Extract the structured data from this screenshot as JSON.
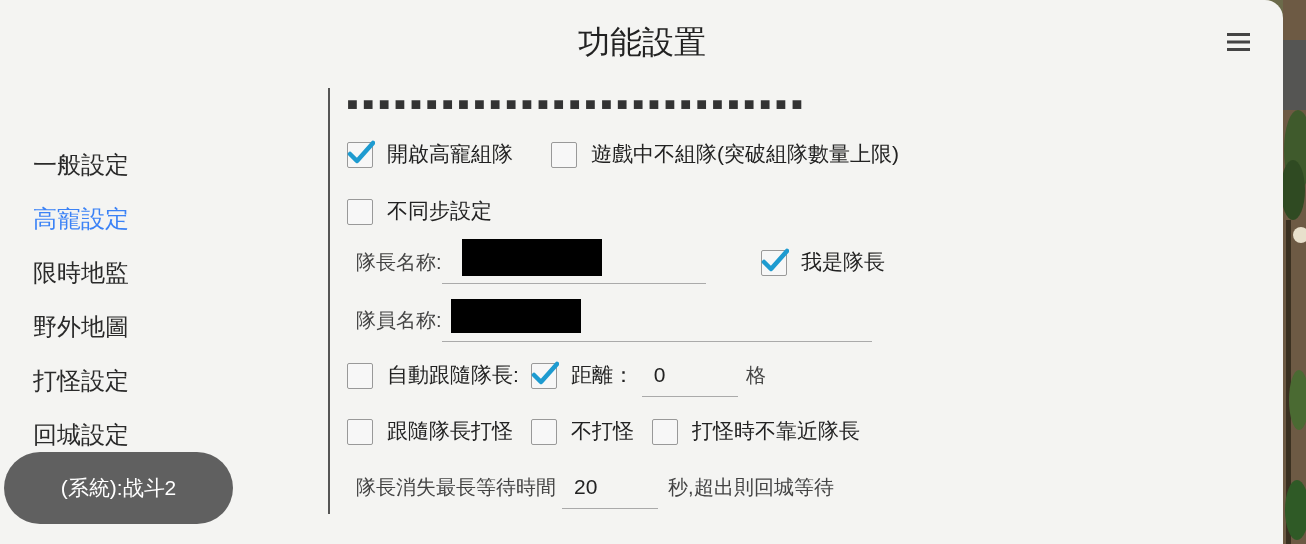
{
  "title": "功能設置",
  "sidebar": {
    "items": [
      {
        "label": "一般設定",
        "selected": false
      },
      {
        "label": "高寵設定",
        "selected": true
      },
      {
        "label": "限時地監",
        "selected": false
      },
      {
        "label": "野外地圖",
        "selected": false
      },
      {
        "label": "打怪設定",
        "selected": false
      },
      {
        "label": "回城設定",
        "selected": false
      }
    ]
  },
  "toast": "(系統):战斗2",
  "header_marks": "■■■■■■■■■■■■■■■■■■■■■■■■■■■■■",
  "rows": [
    [
      {
        "kind": "checkbox",
        "label": "開啟高寵組隊",
        "checked": true
      },
      {
        "kind": "checkbox",
        "label": "遊戲中不組隊(突破組隊數量上限)",
        "checked": false
      }
    ],
    [
      {
        "kind": "checkbox",
        "label": "不同步設定",
        "checked": false
      }
    ],
    [
      {
        "kind": "label",
        "text": "隊長名称:"
      },
      {
        "kind": "field",
        "redacted": true
      },
      {
        "kind": "checkbox",
        "label": "我是隊長",
        "checked": true
      }
    ],
    [
      {
        "kind": "label",
        "text": "隊員名称:"
      },
      {
        "kind": "field",
        "redacted": true
      }
    ],
    [
      {
        "kind": "checkbox",
        "label": "自動跟隨隊長:",
        "checked": false
      },
      {
        "kind": "checkbox",
        "label": "距離：",
        "checked": true
      },
      {
        "kind": "field",
        "value": "0"
      },
      {
        "kind": "label",
        "text": "格"
      }
    ],
    [
      {
        "kind": "checkbox",
        "label": "跟隨隊長打怪",
        "checked": false
      },
      {
        "kind": "checkbox",
        "label": "不打怪",
        "checked": false
      },
      {
        "kind": "checkbox",
        "label": "打怪時不靠近隊長",
        "checked": false
      }
    ],
    [
      {
        "kind": "label",
        "text": "隊長消失最長等待時間"
      },
      {
        "kind": "field",
        "value": "20"
      },
      {
        "kind": "label",
        "text": "秒,超出則回城等待"
      }
    ]
  ]
}
